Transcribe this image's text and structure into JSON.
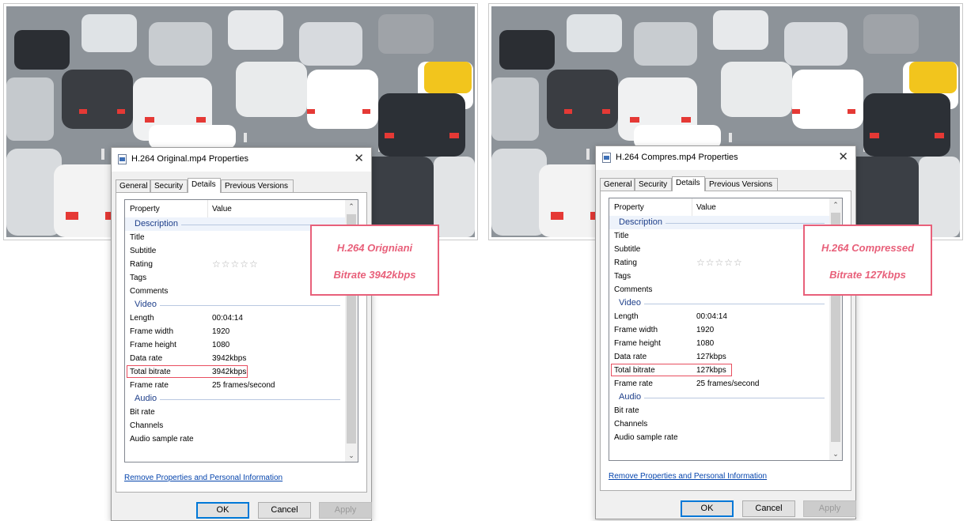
{
  "colors": {
    "annotation": "#e8607a",
    "group_header": "#1e3f8a",
    "link": "#0645ad",
    "ok_border": "#0078d7"
  },
  "left": {
    "dialog": {
      "title": "H.264 Original.mp4 Properties",
      "close_icon": "close-icon",
      "tabs": [
        "General",
        "Security",
        "Details",
        "Previous Versions"
      ],
      "active_tab": "Details",
      "columns": {
        "property": "Property",
        "value": "Value"
      },
      "groups": {
        "description": {
          "label": "Description",
          "rows": [
            {
              "p": "Title",
              "v": ""
            },
            {
              "p": "Subtitle",
              "v": ""
            },
            {
              "p": "Rating",
              "v": "☆☆☆☆☆"
            },
            {
              "p": "Tags",
              "v": ""
            },
            {
              "p": "Comments",
              "v": ""
            }
          ]
        },
        "video": {
          "label": "Video",
          "rows": [
            {
              "p": "Length",
              "v": "00:04:14"
            },
            {
              "p": "Frame width",
              "v": "1920"
            },
            {
              "p": "Frame height",
              "v": "1080"
            },
            {
              "p": "Data rate",
              "v": "3942kbps"
            },
            {
              "p": "Total bitrate",
              "v": "3942kbps"
            },
            {
              "p": "Frame rate",
              "v": "25 frames/second"
            }
          ]
        },
        "audio": {
          "label": "Audio",
          "rows": [
            {
              "p": "Bit rate",
              "v": ""
            },
            {
              "p": "Channels",
              "v": ""
            },
            {
              "p": "Audio sample rate",
              "v": ""
            }
          ]
        }
      },
      "link": "Remove Properties and Personal Information",
      "buttons": {
        "ok": "OK",
        "cancel": "Cancel",
        "apply": "Apply"
      }
    },
    "annotation": {
      "line1": "H.264 Origniani",
      "line2": "Bitrate 3942kbps"
    }
  },
  "right": {
    "dialog": {
      "title": "H.264 Compres.mp4 Properties",
      "close_icon": "close-icon",
      "tabs": [
        "General",
        "Security",
        "Details",
        "Previous Versions"
      ],
      "active_tab": "Details",
      "columns": {
        "property": "Property",
        "value": "Value"
      },
      "groups": {
        "description": {
          "label": "Description",
          "rows": [
            {
              "p": "Title",
              "v": ""
            },
            {
              "p": "Subtitle",
              "v": ""
            },
            {
              "p": "Rating",
              "v": "☆☆☆☆☆"
            },
            {
              "p": "Tags",
              "v": ""
            },
            {
              "p": "Comments",
              "v": ""
            }
          ]
        },
        "video": {
          "label": "Video",
          "rows": [
            {
              "p": "Length",
              "v": "00:04:14"
            },
            {
              "p": "Frame width",
              "v": "1920"
            },
            {
              "p": "Frame height",
              "v": "1080"
            },
            {
              "p": "Data rate",
              "v": "127kbps"
            },
            {
              "p": "Total bitrate",
              "v": "127kbps"
            },
            {
              "p": "Frame rate",
              "v": "25 frames/second"
            }
          ]
        },
        "audio": {
          "label": "Audio",
          "rows": [
            {
              "p": "Bit rate",
              "v": ""
            },
            {
              "p": "Channels",
              "v": ""
            },
            {
              "p": "Audio sample rate",
              "v": ""
            }
          ]
        }
      },
      "link": "Remove Properties and Personal Information",
      "buttons": {
        "ok": "OK",
        "cancel": "Cancel",
        "apply": "Apply"
      }
    },
    "annotation": {
      "line1": "H.264 Compressed",
      "line2": "Bitrate 127kbps"
    }
  }
}
